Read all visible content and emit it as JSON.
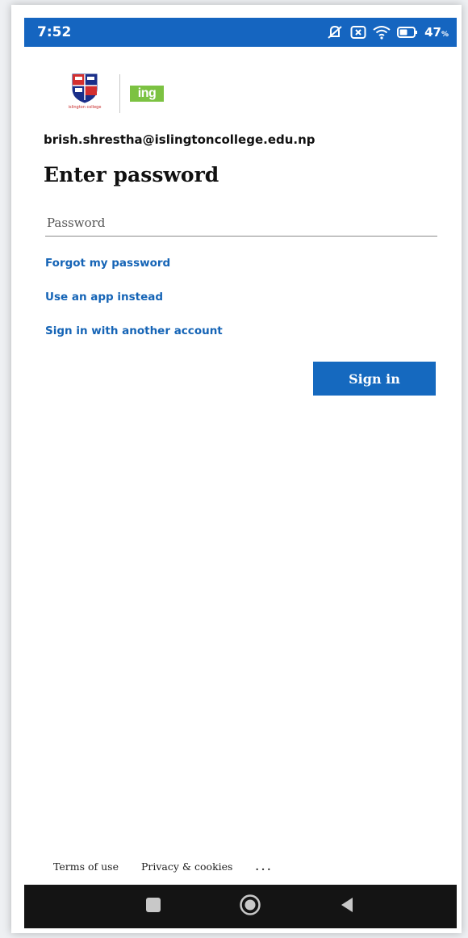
{
  "status_bar": {
    "time": "7:52",
    "battery": "47",
    "icons": [
      "mute-vibrate-icon",
      "sim-x-icon",
      "wifi-icon",
      "battery-icon"
    ],
    "background": "#1565c0"
  },
  "brand": {
    "crest_caption": "islington college",
    "partner_logo": "ing",
    "partner_color": "#7cc242"
  },
  "login": {
    "email": "brish.shrestha@islingtoncollege.edu.np",
    "heading": "Enter password",
    "password_placeholder": "Password",
    "password_value": "",
    "forgot_link": "Forgot my password",
    "app_link": "Use an app instead",
    "other_account_link": "Sign in with another account",
    "signin_label": "Sign in",
    "accent": "#1569bf"
  },
  "footer": {
    "terms": "Terms of use",
    "privacy": "Privacy & cookies",
    "more": "..."
  },
  "nav": {
    "buttons": [
      "recent-apps-icon",
      "home-icon",
      "back-icon"
    ]
  }
}
